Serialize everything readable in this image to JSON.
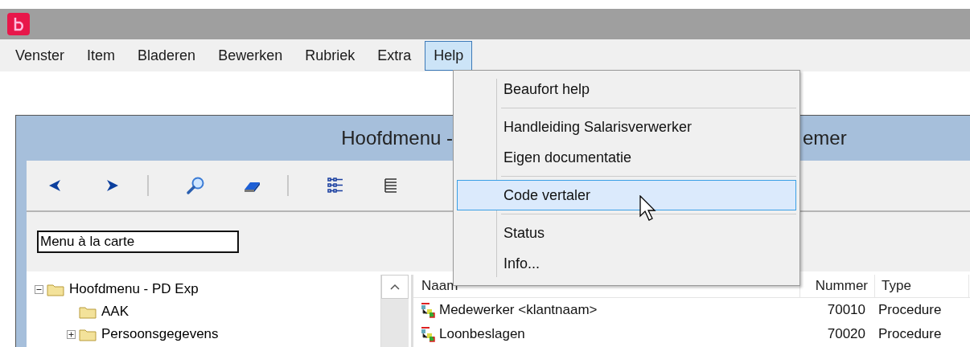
{
  "menu_bar": [
    {
      "label": "Venster",
      "selected": false
    },
    {
      "label": "Item",
      "selected": false
    },
    {
      "label": "Bladeren",
      "selected": false
    },
    {
      "label": "Bewerken",
      "selected": false
    },
    {
      "label": "Rubriek",
      "selected": false
    },
    {
      "label": "Extra",
      "selected": false
    },
    {
      "label": "Help",
      "selected": true
    }
  ],
  "help_menu": [
    {
      "kind": "item",
      "label": "Beaufort help",
      "selected": false
    },
    {
      "kind": "separator"
    },
    {
      "kind": "item",
      "label": "Handleiding Salarisverwerker",
      "selected": false
    },
    {
      "kind": "item",
      "label": "Eigen documentatie",
      "selected": false
    },
    {
      "kind": "separator"
    },
    {
      "kind": "item",
      "label": "Code vertaler",
      "selected": true
    },
    {
      "kind": "separator"
    },
    {
      "kind": "item",
      "label": "Status",
      "selected": false
    },
    {
      "kind": "item",
      "label": "Info...",
      "selected": false
    }
  ],
  "window": {
    "title_start": "Hoofdmenu -",
    "title_end": "emer",
    "toolbar": [
      {
        "kind": "back"
      },
      {
        "kind": "forward"
      },
      {
        "kind": "divider"
      },
      {
        "kind": "search"
      },
      {
        "kind": "eraser"
      },
      {
        "kind": "divider"
      },
      {
        "kind": "tree"
      },
      {
        "kind": "list"
      }
    ],
    "filter_field": {
      "value": "Menu à la carte"
    },
    "tree": [
      {
        "label": "Hoofdmenu - PD Exp",
        "expanded": true,
        "children": [
          {
            "label": "AAK"
          },
          {
            "label": "Persoonsgegevens",
            "expanded": false
          }
        ]
      }
    ],
    "list": {
      "columns": [
        "Naam",
        "Nummer",
        "Type"
      ],
      "rows": [
        {
          "name": "Medewerker <klantnaam>",
          "number": "70010",
          "type": "Procedure"
        },
        {
          "name": "Loonbeslagen",
          "number": "70020",
          "type": "Procedure"
        }
      ]
    }
  }
}
